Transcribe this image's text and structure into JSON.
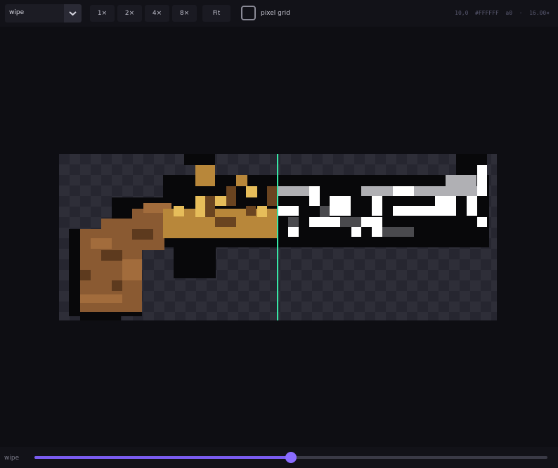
{
  "toolbar": {
    "mode_select": {
      "value": "wipe"
    },
    "zoom_buttons": [
      "1×",
      "2×",
      "4×",
      "8×",
      "Fit"
    ],
    "pixel_grid_label": "pixel grid",
    "pixel_grid_checked": false,
    "status": "10,0  #FFFFFF  a0  ·  16.00×"
  },
  "wipe": {
    "label": "wipe",
    "value": 0.5
  },
  "colors": {
    "accent": "#7a5cf0",
    "wipe_line": "#37e8a6",
    "background": "#0e0e13"
  }
}
